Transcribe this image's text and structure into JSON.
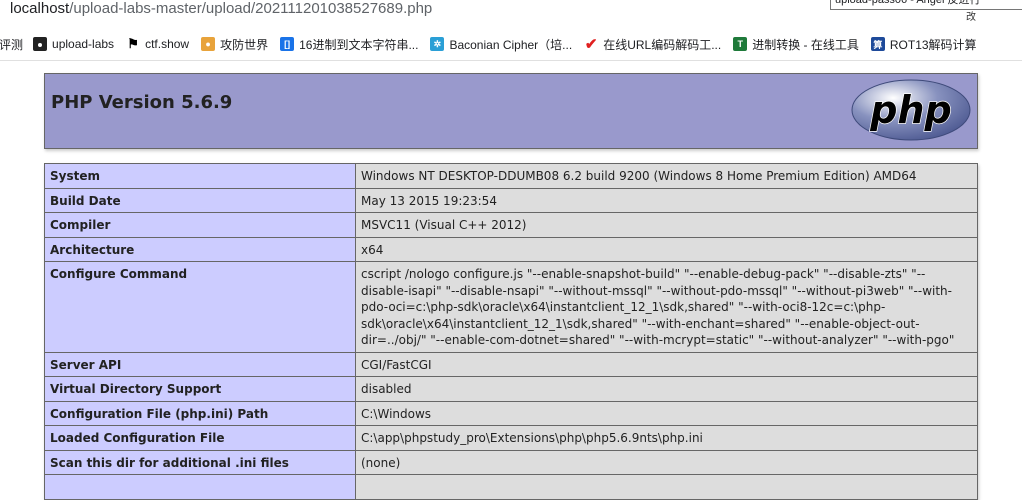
{
  "address_bar": {
    "host": "localhost",
    "path": "/upload-labs-master/upload/202111201038527689.php"
  },
  "tooltip": {
    "text": "upload-pass06 - Angel 反进行",
    "tail": "改"
  },
  "bookmarks": [
    {
      "label": "评测",
      "icon": "none"
    },
    {
      "label": "upload-labs",
      "icon": "folder-icon"
    },
    {
      "label": "ctf.show",
      "icon": "ctf-icon"
    },
    {
      "label": "攻防世界",
      "icon": "shield-icon"
    },
    {
      "label": "16进制到文本字符串...",
      "icon": "bracket-icon"
    },
    {
      "label": "Baconian Cipher（培...",
      "icon": "gear-icon"
    },
    {
      "label": "在线URL编码解码工...",
      "icon": "checkmark-icon"
    },
    {
      "label": "进制转换 - 在线工具",
      "icon": "t-icon"
    },
    {
      "label": "ROT13解码计算",
      "icon": "calculator-icon"
    }
  ],
  "phpinfo": {
    "title": "PHP Version 5.6.9",
    "logo_text": "php",
    "rows": [
      {
        "key": "System",
        "value": "Windows NT DESKTOP-DDUMB08 6.2 build 9200 (Windows 8 Home Premium Edition) AMD64"
      },
      {
        "key": "Build Date",
        "value": "May 13 2015 19:23:54"
      },
      {
        "key": "Compiler",
        "value": "MSVC11 (Visual C++ 2012)"
      },
      {
        "key": "Architecture",
        "value": "x64"
      },
      {
        "key": "Configure Command",
        "value": "cscript /nologo configure.js \"--enable-snapshot-build\" \"--enable-debug-pack\" \"--disable-zts\" \"--disable-isapi\" \"--disable-nsapi\" \"--without-mssql\" \"--without-pdo-mssql\" \"--without-pi3web\" \"--with-pdo-oci=c:\\php-sdk\\oracle\\x64\\instantclient_12_1\\sdk,shared\" \"--with-oci8-12c=c:\\php-sdk\\oracle\\x64\\instantclient_12_1\\sdk,shared\" \"--with-enchant=shared\" \"--enable-object-out-dir=../obj/\" \"--enable-com-dotnet=shared\" \"--with-mcrypt=static\" \"--without-analyzer\" \"--with-pgo\""
      },
      {
        "key": "Server API",
        "value": "CGI/FastCGI"
      },
      {
        "key": "Virtual Directory Support",
        "value": "disabled"
      },
      {
        "key": "Configuration File (php.ini) Path",
        "value": "C:\\Windows"
      },
      {
        "key": "Loaded Configuration File",
        "value": "C:\\app\\phpstudy_pro\\Extensions\\php\\php5.6.9nts\\php.ini"
      },
      {
        "key": "Scan this dir for additional .ini files",
        "value": "(none)"
      },
      {
        "key": "",
        "value": ""
      }
    ]
  },
  "colors": {
    "header_bg": "#9999cc",
    "key_bg": "#ccccff",
    "value_bg": "#dddddd",
    "border": "#666666"
  }
}
